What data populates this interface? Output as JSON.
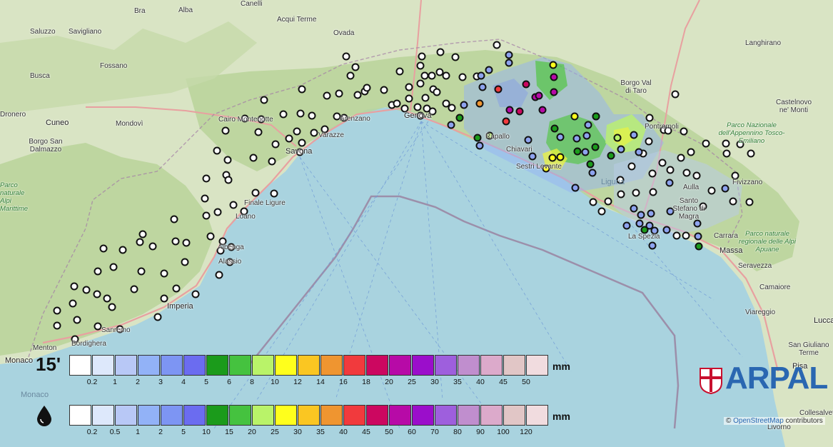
{
  "legend_15min": {
    "label": "15'",
    "unit": "mm",
    "ticks": [
      "0.2",
      "1",
      "2",
      "3",
      "4",
      "5",
      "6",
      "8",
      "10",
      "12",
      "14",
      "16",
      "18",
      "20",
      "25",
      "30",
      "35",
      "40",
      "45",
      "50"
    ]
  },
  "legend_total": {
    "icon": "raindrop-icon",
    "unit": "mm",
    "ticks": [
      "0.2",
      "0.5",
      "1",
      "2",
      "5",
      "10",
      "15",
      "20",
      "25",
      "30",
      "35",
      "40",
      "45",
      "50",
      "60",
      "70",
      "80",
      "90",
      "100",
      "120"
    ]
  },
  "colors": [
    "#ffffff",
    "#dde8fb",
    "#b8c8f6",
    "#92b2f7",
    "#7d95f3",
    "#6b6cf0",
    "#1b9b1b",
    "#45c23f",
    "#b9f369",
    "#ffff1c",
    "#fac622",
    "#ef9530",
    "#f13a3d",
    "#cc0760",
    "#b70aa7",
    "#9b0ecb",
    "#9e5fdd",
    "#c08ece",
    "#dcaacb",
    "#e1c6c6",
    "#f1dcdf"
  ],
  "brand": {
    "name": "ARPAL",
    "blue": "#2a67b1",
    "red": "#c8102e"
  },
  "attribution": {
    "symbol": "©",
    "link": "OpenStreetMap",
    "suffix": "contributors"
  },
  "places": [
    {
      "name": "Canelli",
      "cls": ""
    },
    {
      "name": "Alba",
      "cls": ""
    },
    {
      "name": "Bra",
      "cls": ""
    },
    {
      "name": "Acqui Terme",
      "cls": ""
    },
    {
      "name": "Ovada",
      "cls": ""
    },
    {
      "name": "Saluzzo",
      "cls": ""
    },
    {
      "name": "Savigliano",
      "cls": ""
    },
    {
      "name": "Busca",
      "cls": ""
    },
    {
      "name": "Fossano",
      "cls": ""
    },
    {
      "name": "Dronero",
      "cls": ""
    },
    {
      "name": "Cuneo",
      "cls": "big"
    },
    {
      "name": "Mondovì",
      "cls": ""
    },
    {
      "name": "Borgo San Dalmazzo",
      "cls": ""
    },
    {
      "name": "Cairo Montenotte",
      "cls": ""
    },
    {
      "name": "Savona",
      "cls": "big"
    },
    {
      "name": "Varazze",
      "cls": ""
    },
    {
      "name": "Arenzano",
      "cls": ""
    },
    {
      "name": "Genova",
      "cls": "big"
    },
    {
      "name": "Finale Ligure",
      "cls": ""
    },
    {
      "name": "Loano",
      "cls": ""
    },
    {
      "name": "Albenga",
      "cls": ""
    },
    {
      "name": "Alassio",
      "cls": ""
    },
    {
      "name": "Imperia",
      "cls": "big"
    },
    {
      "name": "Sanremo",
      "cls": ""
    },
    {
      "name": "Bordighera",
      "cls": ""
    },
    {
      "name": "Menton",
      "cls": ""
    },
    {
      "name": "Monaco",
      "cls": "big"
    },
    {
      "name": "Monaco",
      "cls": "sea"
    },
    {
      "name": "Chiavari",
      "cls": ""
    },
    {
      "name": "Sestri Levante",
      "cls": ""
    },
    {
      "name": "Rapallo",
      "cls": ""
    },
    {
      "name": "Borgo Val di Taro",
      "cls": ""
    },
    {
      "name": "Pontremoli",
      "cls": ""
    },
    {
      "name": "Fivizzano",
      "cls": ""
    },
    {
      "name": "Aulla",
      "cls": ""
    },
    {
      "name": "Santo Stefano di Magra",
      "cls": ""
    },
    {
      "name": "La Spezia",
      "cls": ""
    },
    {
      "name": "Carrara",
      "cls": ""
    },
    {
      "name": "Massa",
      "cls": "big"
    },
    {
      "name": "Seravezza",
      "cls": ""
    },
    {
      "name": "Camaiore",
      "cls": ""
    },
    {
      "name": "Viareggio",
      "cls": ""
    },
    {
      "name": "Lucca",
      "cls": "big"
    },
    {
      "name": "San Giuliano Terme",
      "cls": ""
    },
    {
      "name": "Pisa",
      "cls": "big"
    },
    {
      "name": "Collesalvetti",
      "cls": ""
    },
    {
      "name": "Livorno",
      "cls": ""
    },
    {
      "name": "Langhirano",
      "cls": ""
    },
    {
      "name": "Castelnovo ne' Monti",
      "cls": ""
    },
    {
      "name": "Parco Nazionale dell'Appennino Tosco-Emiliano",
      "cls": "green"
    },
    {
      "name": "Parco naturale regionale delle Alpi Apuane",
      "cls": "green"
    },
    {
      "name": "Parco naturale Alpi Marittime",
      "cls": "green"
    },
    {
      "name": "Liguria",
      "cls": "sea"
    }
  ]
}
